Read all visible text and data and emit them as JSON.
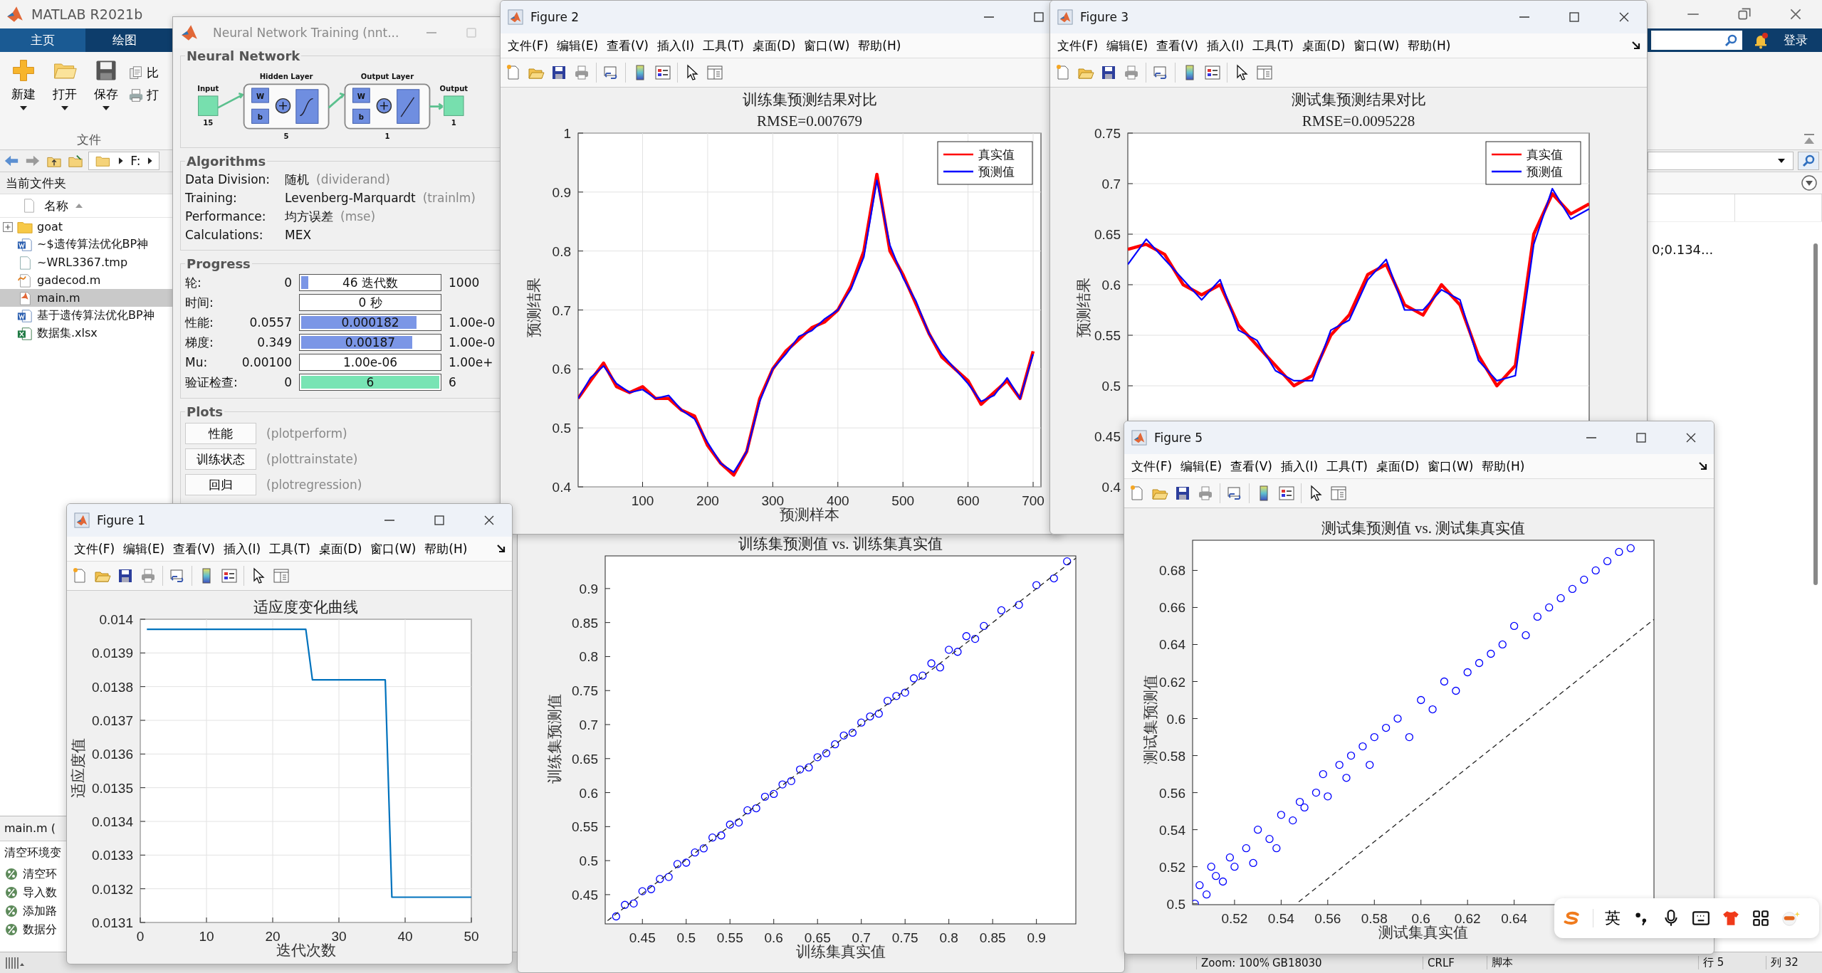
{
  "matlab": {
    "title": "MATLAB R2021b",
    "tabs": [
      {
        "label": "主页",
        "selected": true
      },
      {
        "label": "绘图",
        "selected": false
      }
    ],
    "file_buttons": [
      {
        "label": "新建",
        "kind": "new"
      },
      {
        "label": "打开",
        "kind": "open"
      },
      {
        "label": "保存",
        "kind": "save"
      }
    ],
    "small_buttons": [
      {
        "label": "比",
        "kind": "compare"
      },
      {
        "label": "打",
        "kind": "print"
      }
    ],
    "section_label": "文件",
    "sign_in": "登录"
  },
  "address_bar": {
    "path": "F:"
  },
  "current_folder": {
    "title": "当前文件夹",
    "column": "名称",
    "files": [
      {
        "name": "goat",
        "kind": "folder",
        "selected": false
      },
      {
        "name": "~$遗传算法优化BP神",
        "kind": "word",
        "selected": false
      },
      {
        "name": "~WRL3367.tmp",
        "kind": "file",
        "selected": false
      },
      {
        "name": "gadecod.m",
        "kind": "function",
        "selected": false
      },
      {
        "name": "main.m",
        "kind": "script",
        "selected": true
      },
      {
        "name": "基于遗传算法优化BP神",
        "kind": "word",
        "selected": false
      },
      {
        "name": "数据集.xlsx",
        "kind": "excel",
        "selected": false
      }
    ]
  },
  "details": {
    "title": "main.m  (",
    "summary": "清空环境变",
    "items": [
      "清空环",
      "导入数",
      "添加路",
      "数据分"
    ]
  },
  "workspace": {
    "value": "0;0.134..."
  },
  "status_bar": {
    "zoom": "Zoom: 100%",
    "encoding": "GB18030",
    "line_ending": "CRLF",
    "file_type": "脚本",
    "line": "行  5",
    "column": "列  32"
  },
  "nn_training": {
    "title": "Neural Network Training (nnt...",
    "network": {
      "title": "Neural Network",
      "input_label": "Input",
      "input_size": "15",
      "output_label": "Output",
      "output_size": "1",
      "layers": [
        {
          "title": "Hidden Layer",
          "size": "5",
          "weight": "W",
          "bias": "b",
          "kind": "sigmoid"
        },
        {
          "title": "Output Layer",
          "size": "1",
          "weight": "W",
          "bias": "b",
          "kind": "linear"
        }
      ]
    },
    "algorithms": {
      "title": "Algorithms",
      "rows": [
        {
          "label": "Data Division:",
          "value": "随机",
          "note": "(dividerand)"
        },
        {
          "label": "Training:",
          "value": "Levenberg-Marquardt",
          "note": "(trainlm)"
        },
        {
          "label": "Performance:",
          "value": "均方误差",
          "note": "(mse)"
        },
        {
          "label": "Calculations:",
          "value": "MEX"
        }
      ]
    },
    "progress": {
      "title": "Progress",
      "rows": [
        {
          "label": "轮:",
          "start": "0",
          "bar": "46 迭代数",
          "level": 0.05,
          "color": "#7b96e6",
          "end": "1000"
        },
        {
          "label": "时间:",
          "bar": "0 秒"
        },
        {
          "label": "性能:",
          "start": "0.0557",
          "bar": "0.000182",
          "level": 0.82,
          "color": "#7b96e6",
          "end": "1.00e-0"
        },
        {
          "label": "梯度:",
          "start": "0.349",
          "bar": "0.00187",
          "level": 0.79,
          "color": "#7b96e6",
          "end": "1.00e-0"
        },
        {
          "label": "Mu:",
          "start": "0.00100",
          "bar": "1.00e-06",
          "end": "1.00e+"
        },
        {
          "label": "验证检查:",
          "start": "0",
          "bar": "6",
          "level": 1,
          "color": "#78e4b4",
          "end": "6"
        }
      ]
    },
    "plots": {
      "title": "Plots",
      "buttons": [
        {
          "label": "性能",
          "note": "(plotperform)"
        },
        {
          "label": "训练状态",
          "note": "(plottrainstate)"
        },
        {
          "label": "回归",
          "note": "(plotregression)"
        }
      ]
    }
  },
  "figures": [
    {
      "window_title": "Figure 2",
      "menus": [
        "文件(F)",
        "编辑(E)",
        "查看(V)",
        "插入(I)",
        "工具(T)",
        "桌面(D)",
        "窗口(W)",
        "帮助(H)"
      ],
      "subtitle": "RMSE=0.007679",
      "chart_data": {
        "type": "line",
        "grid": true,
        "legend": "upper right",
        "title": "训练集预测结果对比",
        "xlabel": "预测样本",
        "ylabel": "预测结果",
        "x": [
          1,
          20,
          40,
          60,
          80,
          100,
          120,
          140,
          160,
          180,
          200,
          220,
          240,
          260,
          280,
          300,
          320,
          340,
          360,
          380,
          400,
          420,
          440,
          460,
          480,
          500,
          520,
          540,
          560,
          580,
          600,
          620,
          640,
          660,
          680,
          700
        ],
        "series": [
          {
            "name": "真实值",
            "color": "#ff0000",
            "values": [
              0.55,
              0.58,
              0.61,
              0.57,
              0.56,
              0.57,
              0.55,
              0.55,
              0.53,
              0.52,
              0.47,
              0.44,
              0.42,
              0.46,
              0.55,
              0.6,
              0.63,
              0.65,
              0.67,
              0.68,
              0.7,
              0.74,
              0.8,
              0.93,
              0.8,
              0.76,
              0.71,
              0.66,
              0.62,
              0.6,
              0.58,
              0.54,
              0.56,
              0.58,
              0.55,
              0.63
            ]
          },
          {
            "name": "预测值",
            "color": "#0000ff",
            "values": [
              0.55,
              0.585,
              0.605,
              0.575,
              0.56,
              0.565,
              0.55,
              0.555,
              0.53,
              0.515,
              0.475,
              0.44,
              0.425,
              0.46,
              0.545,
              0.6,
              0.625,
              0.655,
              0.665,
              0.685,
              0.7,
              0.735,
              0.79,
              0.92,
              0.81,
              0.755,
              0.715,
              0.66,
              0.625,
              0.6,
              0.575,
              0.545,
              0.555,
              0.585,
              0.55,
              0.625
            ]
          }
        ],
        "xlim": [
          1,
          712
        ],
        "ylim": [
          0.4,
          1
        ],
        "xticks": [
          100,
          200,
          300,
          400,
          500,
          600,
          700
        ],
        "yticks": [
          0.4,
          0.5,
          0.6,
          0.7,
          0.8,
          0.9,
          1
        ]
      }
    },
    {
      "window_title": "Figure 3",
      "menus": [
        "文件(F)",
        "编辑(E)",
        "查看(V)",
        "插入(I)",
        "工具(T)",
        "桌面(D)",
        "窗口(W)",
        "帮助(H)"
      ],
      "subtitle": "RMSE=0.0095228",
      "chart_data": {
        "type": "line",
        "grid": true,
        "legend": "upper right",
        "title": "测试集预测结果对比",
        "ylabel": "预测结果",
        "categories": [
          null,
          null,
          null,
          null,
          null,
          null,
          null,
          null,
          null,
          null,
          null,
          null,
          null,
          null,
          null,
          null,
          null,
          null,
          null,
          null,
          null,
          null,
          null,
          null,
          null,
          null
        ],
        "series": [
          {
            "name": "真实值",
            "color": "#ff0000",
            "values": [
              0.635,
              0.64,
              0.63,
              0.6,
              0.59,
              0.6,
              0.56,
              0.54,
              0.52,
              0.5,
              0.51,
              0.55,
              0.57,
              0.61,
              0.62,
              0.58,
              0.57,
              0.6,
              0.58,
              0.53,
              0.5,
              0.52,
              0.65,
              0.69,
              0.67,
              0.68
            ]
          },
          {
            "name": "预测值",
            "color": "#0000ff",
            "values": [
              0.62,
              0.645,
              0.625,
              0.605,
              0.585,
              0.605,
              0.555,
              0.545,
              0.515,
              0.505,
              0.505,
              0.555,
              0.565,
              0.605,
              0.625,
              0.575,
              0.575,
              0.595,
              0.585,
              0.525,
              0.505,
              0.51,
              0.64,
              0.695,
              0.665,
              0.675
            ]
          }
        ],
        "ylim": [
          0.4,
          0.75
        ],
        "yticks": [
          0.4,
          0.45,
          0.5,
          0.55,
          0.6,
          0.65,
          0.7,
          0.75
        ]
      }
    },
    {
      "window_title": "Figure 1",
      "menus": [
        "文件(F)",
        "编辑(E)",
        "查看(V)",
        "插入(I)",
        "工具(T)",
        "桌面(D)",
        "窗口(W)",
        "帮助(H)"
      ],
      "chart_data": {
        "type": "line",
        "grid": true,
        "title": "适应度变化曲线",
        "xlabel": "迭代次数",
        "ylabel": "适应度值",
        "x": [
          1,
          25,
          26,
          37,
          38,
          50
        ],
        "series": [
          {
            "color": "#0072bd",
            "values": [
              0.01397,
              0.01397,
              0.01382,
              0.01382,
              0.013175,
              0.013175
            ]
          }
        ],
        "xlim": [
          0,
          50
        ],
        "ylim": [
          0.0131,
          0.014
        ],
        "xticks": [
          0,
          10,
          20,
          30,
          40,
          50
        ],
        "yticks": [
          0.0131,
          0.0132,
          0.0133,
          0.0134,
          0.0135,
          0.0136,
          0.0137,
          0.0138,
          0.0139,
          0.014
        ]
      }
    },
    {
      "chart_data": {
        "type": "scatter",
        "title": "训练集预测值 vs. 训练集真实值",
        "xlabel": "训练集真实值",
        "ylabel": "训练集预测值",
        "x": [
          0.42,
          0.43,
          0.44,
          0.45,
          0.46,
          0.47,
          0.48,
          0.49,
          0.5,
          0.51,
          0.52,
          0.53,
          0.54,
          0.55,
          0.56,
          0.57,
          0.58,
          0.59,
          0.6,
          0.61,
          0.62,
          0.63,
          0.64,
          0.65,
          0.66,
          0.67,
          0.68,
          0.69,
          0.7,
          0.71,
          0.72,
          0.73,
          0.74,
          0.75,
          0.76,
          0.77,
          0.78,
          0.79,
          0.8,
          0.81,
          0.82,
          0.83,
          0.84,
          0.86,
          0.88,
          0.9,
          0.92,
          0.935
        ],
        "series": [
          {
            "color": "#0000ff",
            "values": [
              0.418,
              0.435,
              0.437,
              0.455,
              0.458,
              0.473,
              0.476,
              0.495,
              0.497,
              0.512,
              0.518,
              0.534,
              0.537,
              0.553,
              0.556,
              0.574,
              0.577,
              0.594,
              0.598,
              0.612,
              0.617,
              0.634,
              0.637,
              0.652,
              0.658,
              0.671,
              0.684,
              0.688,
              0.703,
              0.712,
              0.716,
              0.735,
              0.742,
              0.747,
              0.768,
              0.772,
              0.79,
              0.784,
              0.81,
              0.807,
              0.83,
              0.826,
              0.845,
              0.868,
              0.876,
              0.905,
              0.915,
              0.94
            ]
          }
        ],
        "xlim": [
          0.4075,
          0.945
        ],
        "ylim": [
          0.407,
          0.948
        ],
        "xticks": [
          0.45,
          0.5,
          0.55,
          0.6,
          0.65,
          0.7,
          0.75,
          0.8,
          0.85,
          0.9
        ],
        "yticks": [
          0.45,
          0.5,
          0.55,
          0.6,
          0.65,
          0.7,
          0.75,
          0.8,
          0.85,
          0.9
        ]
      }
    },
    {
      "window_title": "Figure 5",
      "menus": [
        "文件(F)",
        "编辑(E)",
        "查看(V)",
        "插入(I)",
        "工具(T)",
        "桌面(D)",
        "窗口(W)",
        "帮助(H)"
      ],
      "chart_data": {
        "type": "scatter",
        "title": "测试集预测值 vs. 测试集真实值",
        "xlabel": "测试集真实值",
        "ylabel": "测试集预测值",
        "x": [
          0.503,
          0.505,
          0.508,
          0.51,
          0.512,
          0.515,
          0.518,
          0.52,
          0.525,
          0.528,
          0.53,
          0.535,
          0.538,
          0.54,
          0.545,
          0.548,
          0.55,
          0.555,
          0.558,
          0.56,
          0.565,
          0.568,
          0.57,
          0.575,
          0.578,
          0.58,
          0.585,
          0.59,
          0.595,
          0.6,
          0.605,
          0.61,
          0.615,
          0.62,
          0.625,
          0.63,
          0.635,
          0.64,
          0.645,
          0.65,
          0.655,
          0.66,
          0.665,
          0.67,
          0.675,
          0.68,
          0.685,
          0.69
        ],
        "series": [
          {
            "color": "#0000ff",
            "values": [
              0.5,
              0.51,
              0.505,
              0.52,
              0.515,
              0.512,
              0.525,
              0.52,
              0.53,
              0.522,
              0.54,
              0.535,
              0.53,
              0.548,
              0.545,
              0.555,
              0.552,
              0.56,
              0.57,
              0.558,
              0.575,
              0.568,
              0.58,
              0.585,
              0.575,
              0.59,
              0.595,
              0.6,
              0.59,
              0.61,
              0.605,
              0.62,
              0.615,
              0.625,
              0.63,
              0.635,
              0.64,
              0.65,
              0.645,
              0.655,
              0.66,
              0.665,
              0.67,
              0.675,
              0.68,
              0.685,
              0.69,
              0.692
            ]
          }
        ],
        "xlim": [
          0.502,
          0.7
        ],
        "ylim": [
          0.4995,
          0.6963
        ],
        "xticks": [
          0.52,
          0.54,
          0.56,
          0.58,
          0.6,
          0.62,
          0.64
        ],
        "yticks": [
          0.5,
          0.52,
          0.54,
          0.56,
          0.58,
          0.6,
          0.62,
          0.64,
          0.66,
          0.68
        ]
      }
    }
  ],
  "ime_bar": {
    "mode": "英"
  }
}
